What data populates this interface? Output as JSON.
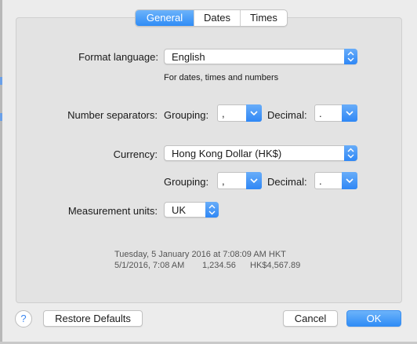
{
  "tabs": [
    {
      "label": "General",
      "active": true
    },
    {
      "label": "Dates",
      "active": false
    },
    {
      "label": "Times",
      "active": false
    }
  ],
  "format_language": {
    "label": "Format language:",
    "value": "English",
    "hint": "For dates, times and numbers"
  },
  "number_separators": {
    "label": "Number separators:",
    "grouping_label": "Grouping:",
    "grouping_value": ",",
    "decimal_label": "Decimal:",
    "decimal_value": "."
  },
  "currency": {
    "label": "Currency:",
    "value": "Hong Kong Dollar (HK$)",
    "grouping_label": "Grouping:",
    "grouping_value": ",",
    "decimal_label": "Decimal:",
    "decimal_value": "."
  },
  "measurement_units": {
    "label": "Measurement units:",
    "value": "UK"
  },
  "sample": {
    "line1": "Tuesday, 5 January 2016 at 7:08:09 AM HKT",
    "line2_date": "5/1/2016, 7:08 AM",
    "line2_number": "1,234.56",
    "line2_currency": "HK$4,567.89"
  },
  "buttons": {
    "help": "?",
    "restore": "Restore Defaults",
    "cancel": "Cancel",
    "ok": "OK"
  },
  "colors": {
    "accent": "#2f8cf6",
    "window_bg": "#ececec",
    "panel_bg": "#e3e3e3"
  }
}
